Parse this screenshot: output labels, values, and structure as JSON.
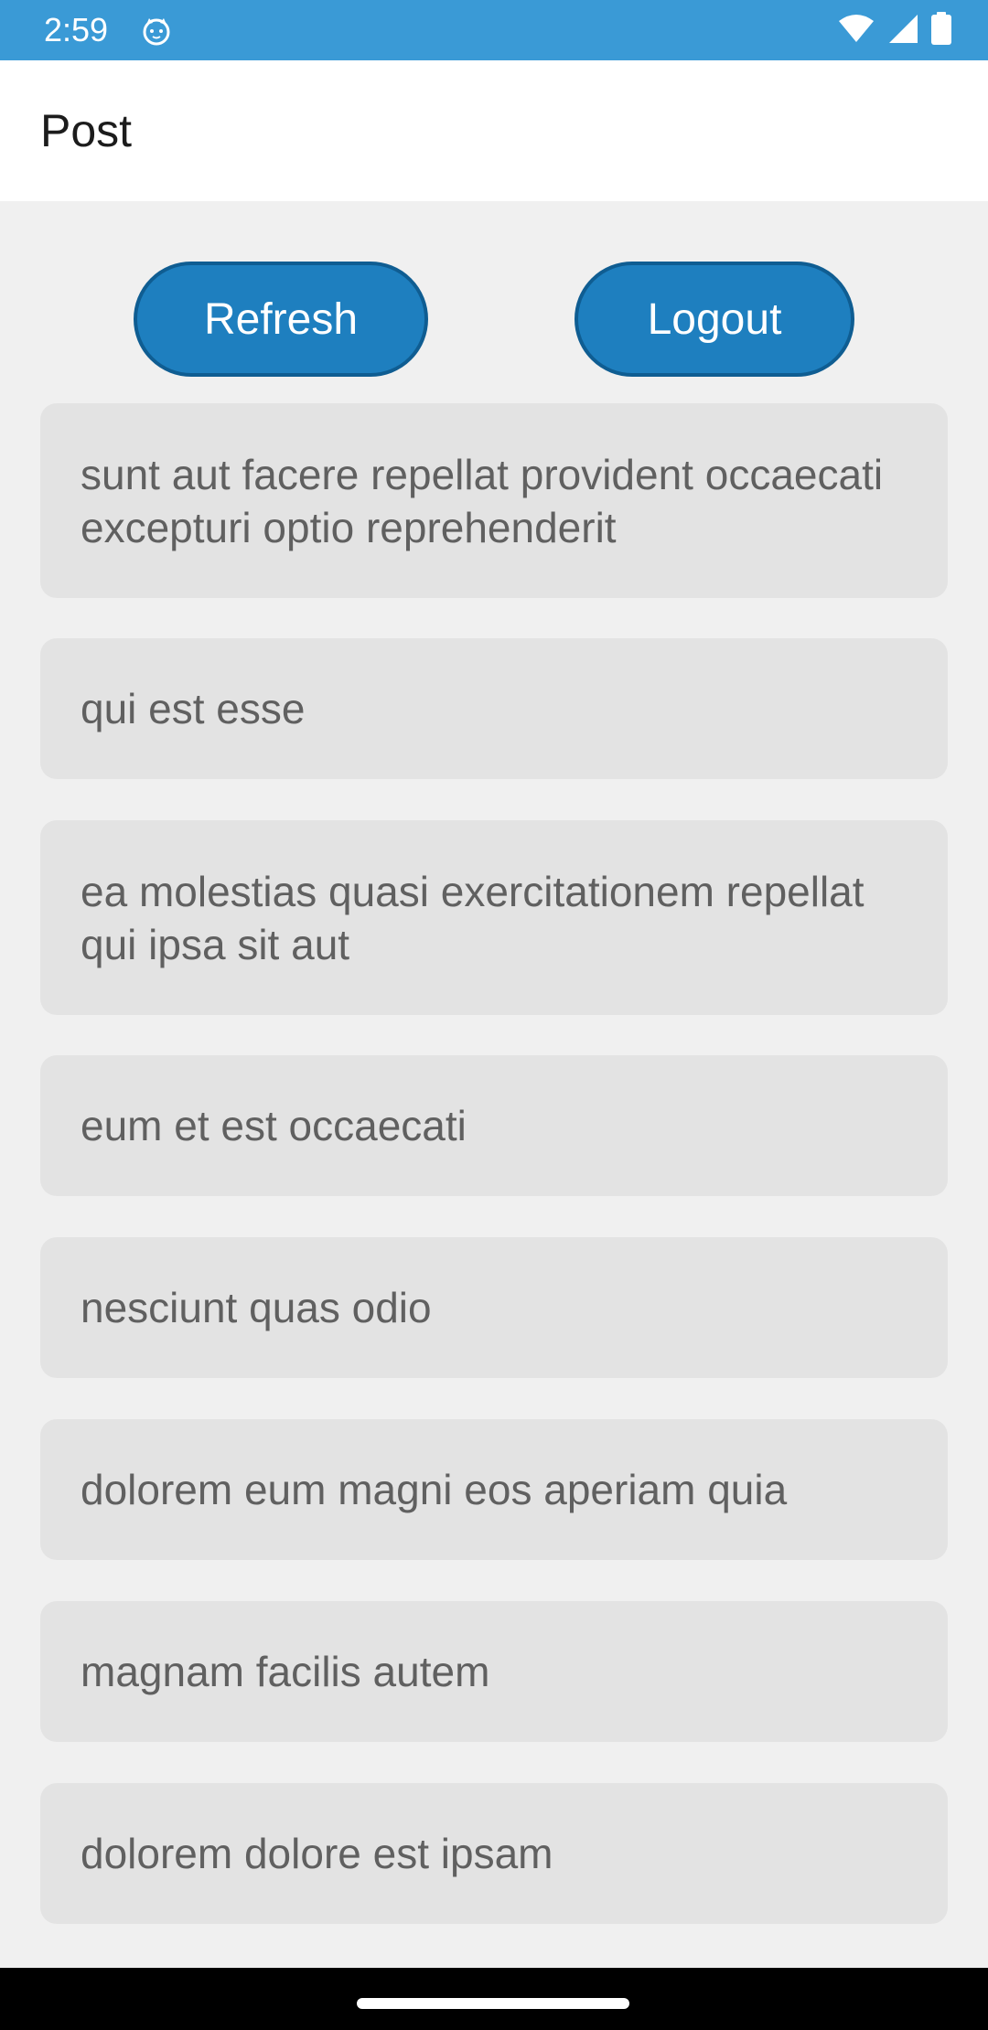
{
  "status_bar": {
    "time": "2:59",
    "icons": [
      "cat-icon",
      "wifi-icon",
      "signal-icon",
      "battery-icon"
    ],
    "color": "#3a9ad6"
  },
  "app_bar": {
    "title": "Post"
  },
  "actions": {
    "refresh_label": "Refresh",
    "logout_label": "Logout",
    "button_color": "#1e7fbf"
  },
  "posts": [
    {
      "title": "sunt aut facere repellat provident occaecati excepturi optio reprehenderit"
    },
    {
      "title": "qui est esse"
    },
    {
      "title": "ea molestias quasi exercitationem repellat qui ipsa sit aut"
    },
    {
      "title": "eum et est occaecati"
    },
    {
      "title": "nesciunt quas odio"
    },
    {
      "title": "dolorem eum magni eos aperiam quia"
    },
    {
      "title": "magnam facilis autem"
    },
    {
      "title": "dolorem dolore est ipsam"
    }
  ]
}
